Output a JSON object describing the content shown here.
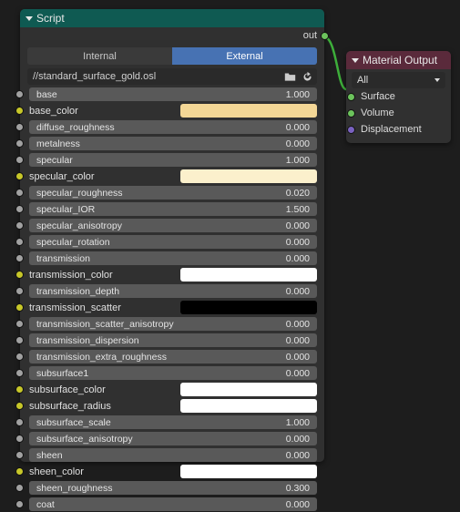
{
  "script_node": {
    "title": "Script",
    "out_label": "out",
    "tabs": {
      "internal": "Internal",
      "external": "External",
      "active": "External"
    },
    "file_path": "//standard_surface_gold.osl",
    "params": [
      {
        "name": "base",
        "kind": "num",
        "value": "1.000"
      },
      {
        "name": "base_color",
        "kind": "color",
        "color": "#F4D796"
      },
      {
        "name": "diffuse_roughness",
        "kind": "num",
        "value": "0.000"
      },
      {
        "name": "metalness",
        "kind": "num",
        "value": "0.000"
      },
      {
        "name": "specular",
        "kind": "num",
        "value": "1.000"
      },
      {
        "name": "specular_color",
        "kind": "color",
        "color": "#FBF0CC"
      },
      {
        "name": "specular_roughness",
        "kind": "num",
        "value": "0.020"
      },
      {
        "name": "specular_IOR",
        "kind": "num",
        "value": "1.500"
      },
      {
        "name": "specular_anisotropy",
        "kind": "num",
        "value": "0.000"
      },
      {
        "name": "specular_rotation",
        "kind": "num",
        "value": "0.000"
      },
      {
        "name": "transmission",
        "kind": "num",
        "value": "0.000"
      },
      {
        "name": "transmission_color",
        "kind": "color",
        "color": "#FFFFFF"
      },
      {
        "name": "transmission_depth",
        "kind": "num",
        "value": "0.000"
      },
      {
        "name": "transmission_scatter",
        "kind": "color",
        "color": "#000000"
      },
      {
        "name": "transmission_scatter_anisotropy",
        "kind": "num",
        "value": "0.000"
      },
      {
        "name": "transmission_dispersion",
        "kind": "num",
        "value": "0.000"
      },
      {
        "name": "transmission_extra_roughness",
        "kind": "num",
        "value": "0.000"
      },
      {
        "name": "subsurface1",
        "kind": "num",
        "value": "0.000"
      },
      {
        "name": "subsurface_color",
        "kind": "color",
        "color": "#FFFFFF"
      },
      {
        "name": "subsurface_radius",
        "kind": "color",
        "color": "#FFFFFF"
      },
      {
        "name": "subsurface_scale",
        "kind": "num",
        "value": "1.000"
      },
      {
        "name": "subsurface_anisotropy",
        "kind": "num",
        "value": "0.000"
      },
      {
        "name": "sheen",
        "kind": "num",
        "value": "0.000"
      },
      {
        "name": "sheen_color",
        "kind": "color",
        "color": "#FFFFFF"
      },
      {
        "name": "sheen_roughness",
        "kind": "num",
        "value": "0.300"
      },
      {
        "name": "coat",
        "kind": "num",
        "value": "0.000"
      }
    ]
  },
  "output_node": {
    "title": "Material Output",
    "dropdown": "All",
    "inputs": [
      {
        "label": "Surface",
        "socket": "green"
      },
      {
        "label": "Volume",
        "socket": "green"
      },
      {
        "label": "Displacement",
        "socket": "purple"
      }
    ]
  }
}
